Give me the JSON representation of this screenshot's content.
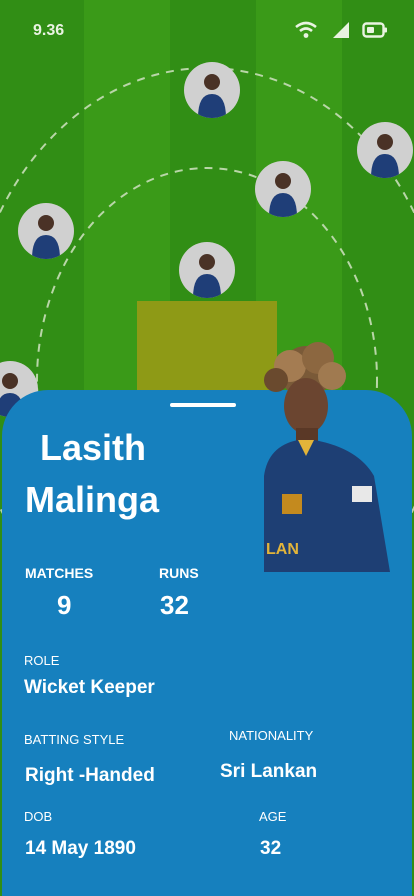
{
  "status": {
    "time": "9.36",
    "icons": [
      "wifi-icon",
      "signal-icon",
      "battery-icon"
    ]
  },
  "colors": {
    "field_dark": "#2f8a14",
    "field_light": "#3a9a18",
    "pitch": "#8e9a16",
    "card": "#1680be",
    "text": "#ffffff"
  },
  "field": {
    "players": [
      {
        "name": "fielder-1"
      },
      {
        "name": "fielder-2"
      },
      {
        "name": "fielder-3"
      },
      {
        "name": "fielder-4"
      },
      {
        "name": "fielder-5"
      },
      {
        "name": "fielder-6"
      }
    ]
  },
  "player": {
    "first_name": "Lasith",
    "last_name": "Malinga",
    "stats": {
      "matches_label": "MATCHES",
      "matches": "9",
      "runs_label": "RUNS",
      "runs": "32"
    },
    "role_label": "ROLE",
    "role": "Wicket Keeper",
    "batting_style_label": "BATTING STYLE",
    "batting_style": "Right -Handed",
    "nationality_label": "NATIONALITY",
    "nationality": "Sri Lankan",
    "dob_label": "DOB",
    "dob": "14 May 1890",
    "age_label": "AGE",
    "age": "32"
  }
}
